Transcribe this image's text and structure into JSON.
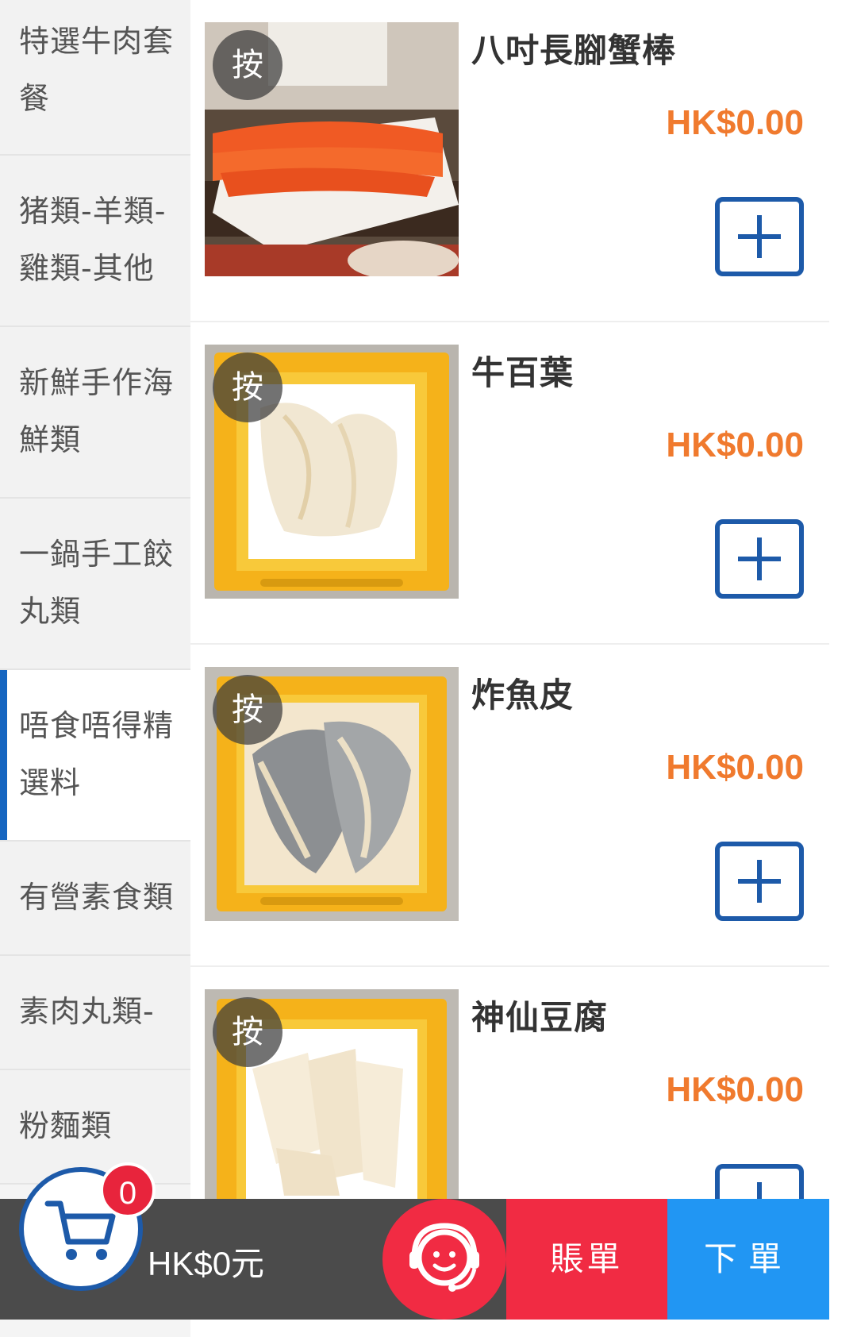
{
  "sidebar": {
    "items": [
      {
        "line1": "特選牛肉套",
        "line2": "餐"
      },
      {
        "line1": "猪類-羊類-",
        "line2": "雞類-其他"
      },
      {
        "line1": "新鮮手作海",
        "line2": "鮮類"
      },
      {
        "line1": "一鍋手工餃",
        "line2": "丸類"
      },
      {
        "line1": "唔食唔得精",
        "line2": "選料"
      },
      {
        "line1": "有營素食類",
        "line2": ""
      },
      {
        "line1": "素肉丸類-",
        "line2": ""
      },
      {
        "line1": "粉麵類",
        "line2": ""
      }
    ],
    "active_index": 4
  },
  "products": [
    {
      "name": "八吋長腳蟹棒",
      "price": "HK$0.00",
      "badge": "按"
    },
    {
      "name": "牛百葉",
      "price": "HK$0.00",
      "badge": "按"
    },
    {
      "name": "炸魚皮",
      "price": "HK$0.00",
      "badge": "按"
    },
    {
      "name": "神仙豆腐",
      "price": "HK$0.00",
      "badge": "按"
    }
  ],
  "cart": {
    "count": "0",
    "total": "HK$0元"
  },
  "actions": {
    "bill": "賬單",
    "order": "下單"
  },
  "colors": {
    "accent_blue": "#1d5aa9",
    "price_orange": "#f07a2e",
    "bill_red": "#f12b43",
    "order_blue": "#2196f3"
  }
}
